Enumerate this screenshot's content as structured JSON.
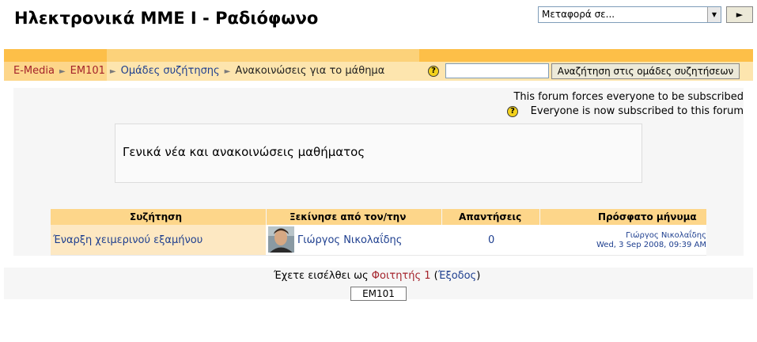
{
  "header": {
    "title": "Ηλεκτρονικά ΜΜΕ Ι - Ραδιόφωνο",
    "jump_select": "Μεταφορά σε...",
    "go_label": "►"
  },
  "breadcrumb": {
    "items": [
      "E-Media",
      "EM101",
      "Ομάδες συζήτησης",
      "Ανακοινώσεις για το μάθημα"
    ],
    "separator": "►"
  },
  "search": {
    "help": "?",
    "value": "",
    "button_label": "Αναζήτηση στις ομάδες συζητήσεων"
  },
  "forum": {
    "subscription_note": "This forum forces everyone to be subscribed",
    "subscription_help": "?",
    "subscription_status": "Everyone is now subscribed to this forum",
    "intro": "Γενικά νέα και ανακοινώσεις μαθήματος"
  },
  "table": {
    "headers": [
      "Συζήτηση",
      "Ξεκίνησε από τον/την",
      "Απαντήσεις",
      "Πρόσφατο μήνυμα"
    ],
    "rows": [
      {
        "topic": "Έναρξη χειμερινού εξαμήνου",
        "starter": "Γιώργος Νικολαΐδης",
        "replies": "0",
        "last_author": "Γιώργος Νικολαΐδης",
        "last_date": "Wed, 3 Sep 2008, 09:39 AM"
      }
    ]
  },
  "footer": {
    "login_prefix": "Έχετε εισέλθει ως ",
    "user": "Φοιτητής 1",
    "paren_open": " (",
    "logout": "Έξοδος",
    "paren_close": ")",
    "course_button": "EM101"
  }
}
